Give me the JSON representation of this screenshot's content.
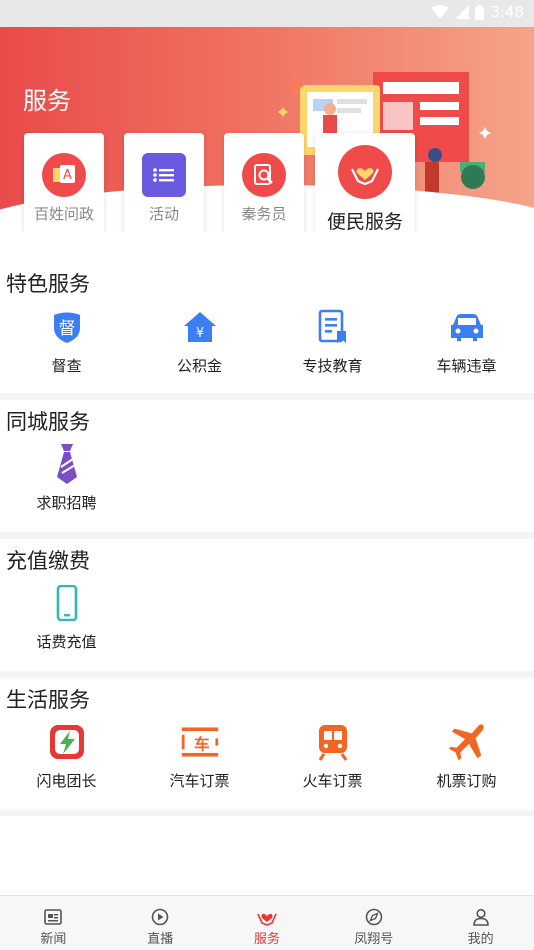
{
  "status_bar": {
    "time": "3:48"
  },
  "header": {
    "title": "服务"
  },
  "quick_entries": [
    {
      "label": "百姓问政",
      "icon": "a-letter-icon",
      "color": "#ef4b4b"
    },
    {
      "label": "活动",
      "icon": "list-board-icon",
      "color": "#6a5ae0"
    },
    {
      "label": "秦务员",
      "icon": "search-doc-icon",
      "color": "#ef4b4b"
    },
    {
      "label": "便民服务",
      "icon": "heart-hands-icon",
      "color": "#ef4b4b"
    }
  ],
  "sections": [
    {
      "title": "特色服务",
      "items": [
        {
          "label": "督查",
          "icon": "supervise-badge-icon",
          "color": "#3b7ff2"
        },
        {
          "label": "公积金",
          "icon": "house-yen-icon",
          "color": "#3b7ff2"
        },
        {
          "label": "专技教育",
          "icon": "document-icon",
          "color": "#3b7ff2"
        },
        {
          "label": "车辆违章",
          "icon": "car-icon",
          "color": "#3b7ff2"
        }
      ]
    },
    {
      "title": "同城服务",
      "items": [
        {
          "label": "求职招聘",
          "icon": "tie-icon",
          "color": "#7a4fc0"
        }
      ]
    },
    {
      "title": "充值缴费",
      "items": [
        {
          "label": "话费充值",
          "icon": "phone-icon",
          "color": "#35b7b7"
        }
      ]
    },
    {
      "title": "生活服务",
      "items": [
        {
          "label": "闪电团长",
          "icon": "lightning-icon",
          "color": "#e53935"
        },
        {
          "label": "汽车订票",
          "icon": "bus-ticket-icon",
          "color": "#f26522"
        },
        {
          "label": "火车订票",
          "icon": "train-icon",
          "color": "#f26522"
        },
        {
          "label": "机票订购",
          "icon": "plane-icon",
          "color": "#f26522"
        }
      ]
    }
  ],
  "tabbar": [
    {
      "label": "新闻",
      "icon": "news-icon",
      "active": false
    },
    {
      "label": "直播",
      "icon": "play-icon",
      "active": false
    },
    {
      "label": "服务",
      "icon": "heart-hand-icon",
      "active": true
    },
    {
      "label": "凤翔号",
      "icon": "compass-icon",
      "active": false
    },
    {
      "label": "我的",
      "icon": "user-icon",
      "active": false
    }
  ]
}
